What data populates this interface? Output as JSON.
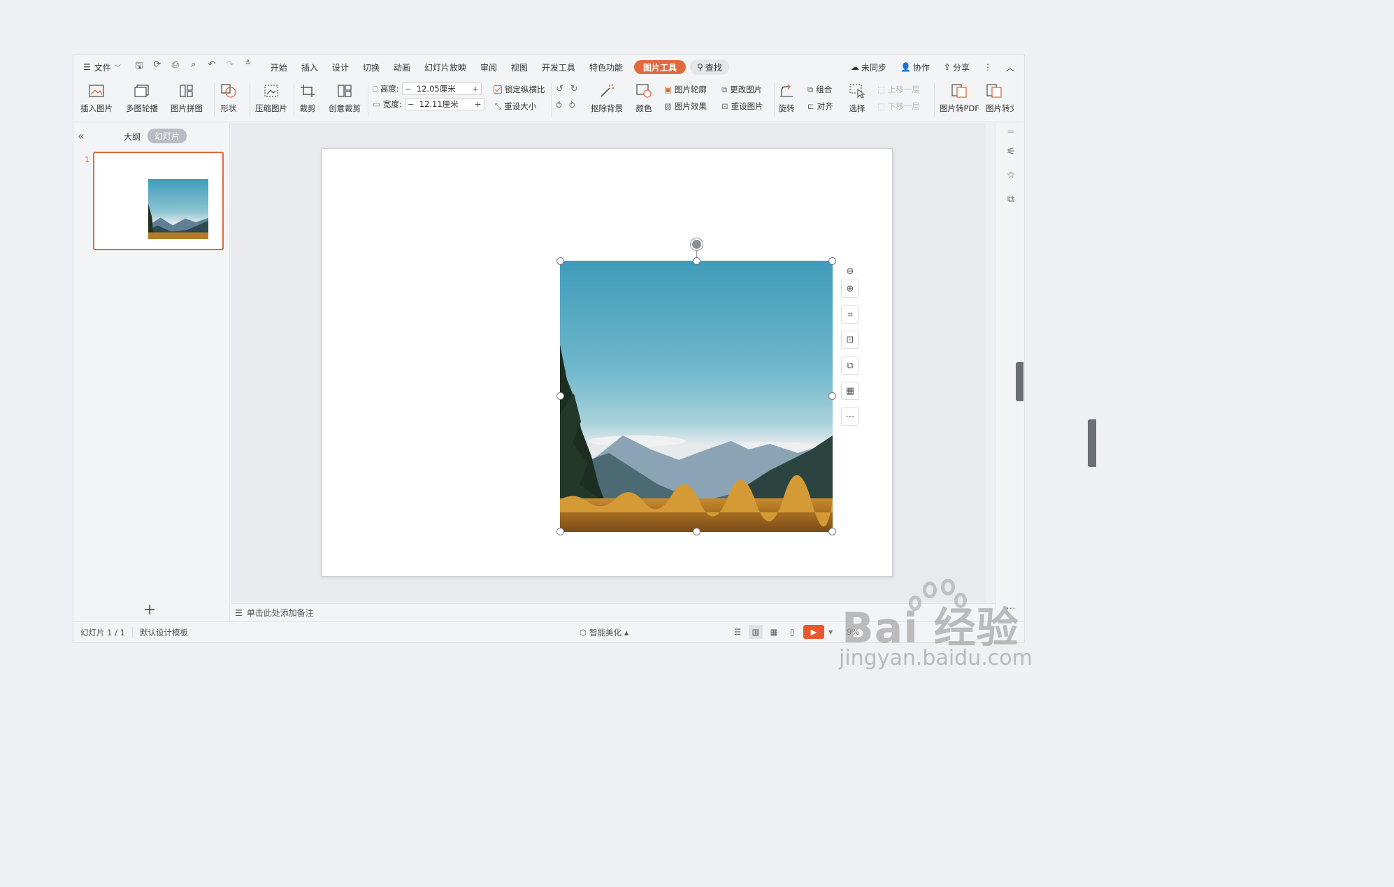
{
  "menu": {
    "file": "文件",
    "tabs": [
      "开始",
      "插入",
      "设计",
      "切换",
      "动画",
      "幻灯片放映",
      "审阅",
      "视图",
      "开发工具",
      "特色功能"
    ],
    "active_tab": "图片工具",
    "search": "查找",
    "right": {
      "sync": "未同步",
      "collab": "协作",
      "share": "分享"
    }
  },
  "ribbon": {
    "insert_picture": "插入图片",
    "multi_carousel": "多图轮播",
    "collage": "图片拼图",
    "shape": "形状",
    "compress": "压缩图片",
    "crop": "裁剪",
    "creative_crop": "创意裁剪",
    "height_label": "高度:",
    "height_value": "12.05厘米",
    "width_label": "宽度:",
    "width_value": "12.11厘米",
    "lock_ratio": "锁定纵横比",
    "reset_size": "重设大小",
    "remove_bg": "抠除背景",
    "color": "颜色",
    "outline": "图片轮廓",
    "effects": "图片效果",
    "change_picture": "更改图片",
    "reset_picture": "重设图片",
    "rotate": "旋转",
    "group": "组合",
    "align": "对齐",
    "select": "选择",
    "bring_forward": "上移一层",
    "send_backward": "下移一层",
    "to_pdf": "图片转PDF",
    "to_more": "图片转文"
  },
  "panel": {
    "outline_tab": "大纲",
    "slides_tab": "幻灯片",
    "slide_number": "1"
  },
  "notes_placeholder": "单击此处添加备注",
  "status": {
    "slide_count": "幻灯片 1 / 1",
    "template": "默认设计模板",
    "beautify": "智能美化",
    "zoom": "9%"
  },
  "watermark": {
    "brand": "Bai  经验",
    "url": "jingyan.baidu.com"
  },
  "colors": {
    "accent": "#e06a3e",
    "play": "#e8572f"
  }
}
